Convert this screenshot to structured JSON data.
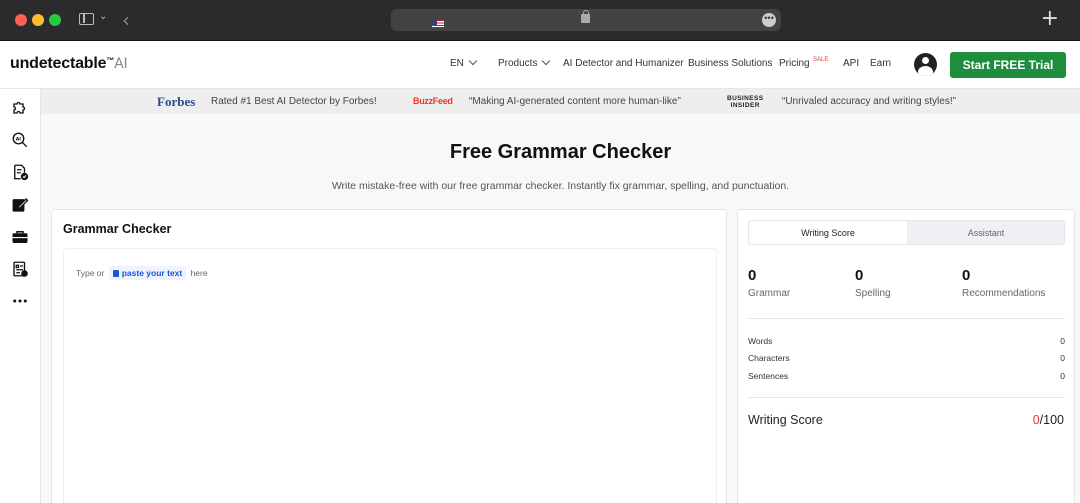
{
  "browser": {
    "back_icon": "chevron-left-icon",
    "add_tab": "+"
  },
  "header": {
    "logo_main": "undetectable",
    "logo_tm": "™",
    "logo_ai": "AI",
    "language": "EN",
    "nav": {
      "products": "Products",
      "ai_detector": "AI Detector and Humanizer",
      "business": "Business Solutions",
      "pricing": "Pricing",
      "sale_badge": "SALE",
      "api": "API",
      "earn": "Earn"
    },
    "cta_label": "Start FREE Trial",
    "cta_color": "#1e8e3e"
  },
  "sidebar": {
    "icons": [
      "puzzle-icon",
      "ai-search-icon",
      "document-check-icon",
      "edit-icon",
      "briefcase-icon",
      "report-icon",
      "more-icon"
    ]
  },
  "press": {
    "forbes_logo": "Forbes",
    "forbes_quote": "Rated #1 Best AI Detector by Forbes!",
    "buzzfeed_logo": "BuzzFeed",
    "buzzfeed_quote": "“Making AI-generated content more human-like”",
    "bi_logo_line1": "BUSINESS",
    "bi_logo_line2": "INSIDER",
    "bi_quote": "“Unrivaled accuracy and writing styles!”"
  },
  "main": {
    "title": "Free Grammar Checker",
    "subtitle": "Write mistake-free with our free grammar checker. Instantly fix grammar, spelling, and punctuation."
  },
  "checker": {
    "title": "Grammar Checker",
    "hint_prefix": "Type or",
    "paste_label": "paste your text",
    "hint_suffix": "here"
  },
  "score_panel": {
    "tabs": [
      "Writing Score",
      "Assistant"
    ],
    "active_tab": "Writing Score",
    "metrics": [
      {
        "value": "0",
        "label": "Grammar"
      },
      {
        "value": "0",
        "label": "Spelling"
      },
      {
        "value": "0",
        "label": "Recommendations"
      }
    ],
    "stats": [
      {
        "label": "Words",
        "value": "0"
      },
      {
        "label": "Characters",
        "value": "0"
      },
      {
        "label": "Sentences",
        "value": "0"
      }
    ],
    "writing_score_label": "Writing Score",
    "writing_score_value": "0",
    "writing_score_max": "/100",
    "score_color": "#e53935"
  }
}
